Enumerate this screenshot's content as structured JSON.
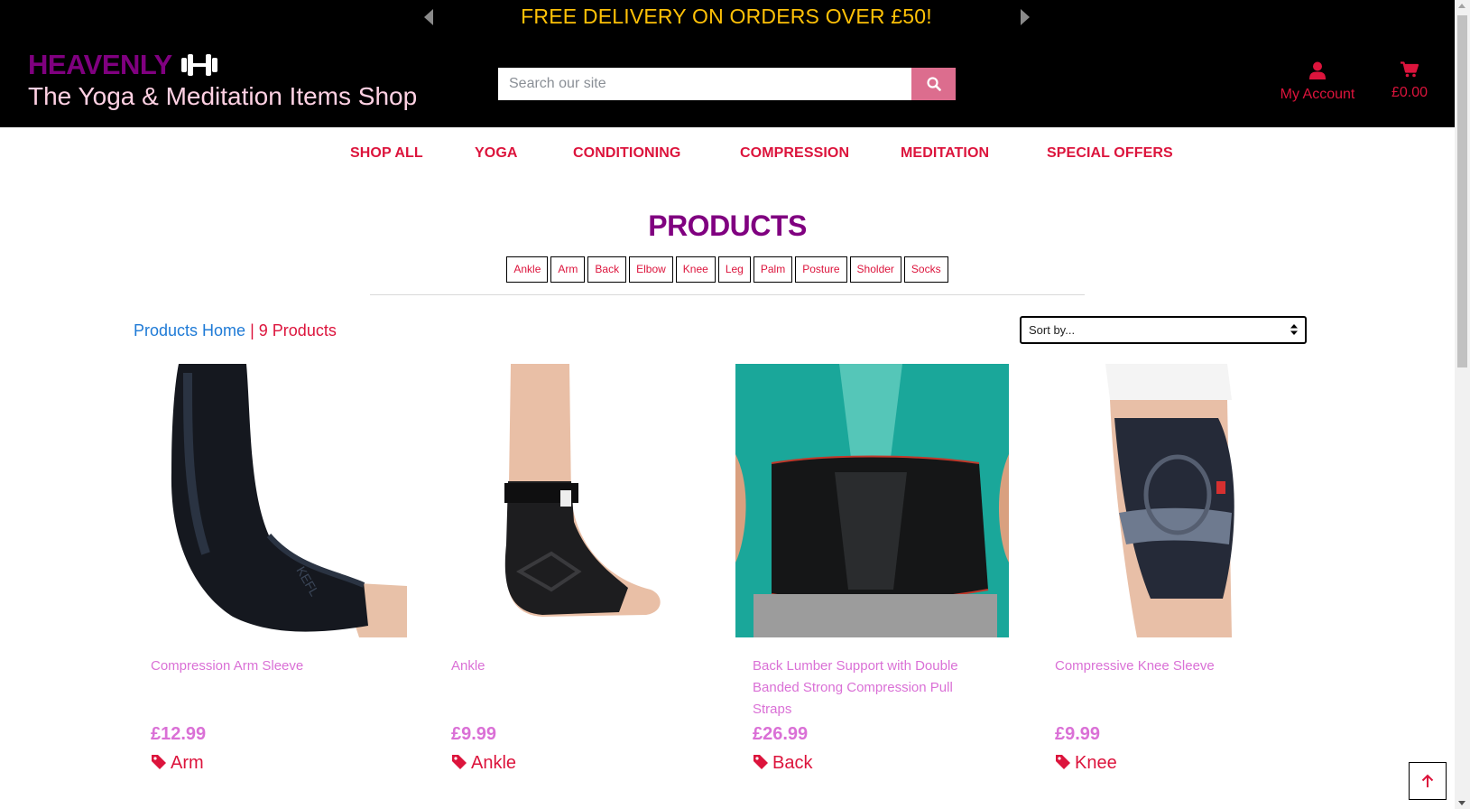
{
  "banner": {
    "text": "FREE DELIVERY ON ORDERS OVER £50!"
  },
  "brand": {
    "name": "HEAVENLY",
    "tagline": "The Yoga & Meditation Items Shop",
    "color": "#800080"
  },
  "search": {
    "placeholder": "Search our site",
    "value": ""
  },
  "account": {
    "label": "My Account"
  },
  "cart": {
    "total": "£0.00"
  },
  "nav": {
    "items": [
      {
        "label": "SHOP ALL"
      },
      {
        "label": "YOGA"
      },
      {
        "label": "CONDITIONING"
      },
      {
        "label": "COMPRESSION"
      },
      {
        "label": "MEDITATION"
      },
      {
        "label": "SPECIAL OFFERS"
      }
    ]
  },
  "page": {
    "title": "PRODUCTS"
  },
  "filters": [
    "Ankle",
    "Arm",
    "Back",
    "Elbow",
    "Knee",
    "Leg",
    "Palm",
    "Posture",
    "Sholder",
    "Socks"
  ],
  "breadcrumb": {
    "home": "Products Home",
    "separator": "|",
    "count": "9 Products"
  },
  "sort": {
    "selected": "Sort by..."
  },
  "products": [
    {
      "name": "Compression Arm Sleeve",
      "price": "£12.99",
      "category": "Arm"
    },
    {
      "name": "Ankle",
      "price": "£9.99",
      "category": "Ankle"
    },
    {
      "name": "Back Lumber Support with Double Banded Strong Compression Pull Straps",
      "price": "£26.99",
      "category": "Back"
    },
    {
      "name": "Compressive Knee Sleeve",
      "price": "£9.99",
      "category": "Knee"
    }
  ],
  "colors": {
    "accent": "#dc143c",
    "brand": "#800080",
    "banner": "#ffc107",
    "product_text": "#da70d6",
    "search_button": "#dc6d8e"
  }
}
